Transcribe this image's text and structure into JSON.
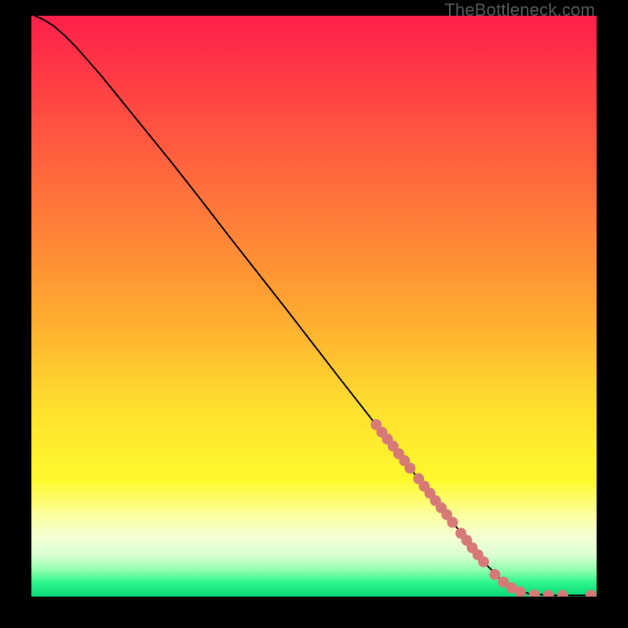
{
  "watermark": "TheBottleneck.com",
  "chart_data": {
    "type": "line",
    "title": "",
    "xlabel": "",
    "ylabel": "",
    "xlim": [
      0,
      100
    ],
    "ylim": [
      0,
      100
    ],
    "grid": false,
    "series": [
      {
        "name": "curve",
        "type": "line",
        "color": "#000000",
        "points": [
          {
            "x": 0.5,
            "y": 100.0
          },
          {
            "x": 2.0,
            "y": 99.4
          },
          {
            "x": 4.0,
            "y": 98.2
          },
          {
            "x": 6.0,
            "y": 96.5
          },
          {
            "x": 8.0,
            "y": 94.5
          },
          {
            "x": 10.0,
            "y": 92.3
          },
          {
            "x": 12.5,
            "y": 89.5
          },
          {
            "x": 15.0,
            "y": 86.5
          },
          {
            "x": 20.0,
            "y": 80.5
          },
          {
            "x": 25.0,
            "y": 74.5
          },
          {
            "x": 30.0,
            "y": 68.3
          },
          {
            "x": 35.0,
            "y": 62.0
          },
          {
            "x": 40.0,
            "y": 55.8
          },
          {
            "x": 45.0,
            "y": 49.6
          },
          {
            "x": 50.0,
            "y": 43.3
          },
          {
            "x": 55.0,
            "y": 37.0
          },
          {
            "x": 60.0,
            "y": 30.8
          },
          {
            "x": 65.0,
            "y": 24.6
          },
          {
            "x": 70.0,
            "y": 18.4
          },
          {
            "x": 75.0,
            "y": 12.2
          },
          {
            "x": 80.0,
            "y": 6.0
          },
          {
            "x": 84.0,
            "y": 2.0
          },
          {
            "x": 88.0,
            "y": 0.5
          },
          {
            "x": 92.0,
            "y": 0.2
          },
          {
            "x": 96.0,
            "y": 0.2
          },
          {
            "x": 99.5,
            "y": 0.2
          }
        ]
      },
      {
        "name": "markers",
        "type": "scatter",
        "color": "#d77a77",
        "points": [
          {
            "x": 61.0,
            "y": 29.6
          },
          {
            "x": 62.0,
            "y": 28.3
          },
          {
            "x": 63.0,
            "y": 27.1
          },
          {
            "x": 64.0,
            "y": 25.9
          },
          {
            "x": 65.0,
            "y": 24.6
          },
          {
            "x": 66.0,
            "y": 23.4
          },
          {
            "x": 67.0,
            "y": 22.1
          },
          {
            "x": 68.5,
            "y": 20.3
          },
          {
            "x": 69.5,
            "y": 19.0
          },
          {
            "x": 70.5,
            "y": 17.8
          },
          {
            "x": 71.5,
            "y": 16.5
          },
          {
            "x": 72.5,
            "y": 15.3
          },
          {
            "x": 73.5,
            "y": 14.1
          },
          {
            "x": 74.5,
            "y": 12.8
          },
          {
            "x": 76.0,
            "y": 10.9
          },
          {
            "x": 77.0,
            "y": 9.7
          },
          {
            "x": 78.0,
            "y": 8.4
          },
          {
            "x": 79.0,
            "y": 7.2
          },
          {
            "x": 80.0,
            "y": 6.0
          },
          {
            "x": 82.0,
            "y": 3.8
          },
          {
            "x": 83.5,
            "y": 2.5
          },
          {
            "x": 85.0,
            "y": 1.5
          },
          {
            "x": 86.5,
            "y": 0.8
          },
          {
            "x": 89.0,
            "y": 0.3
          },
          {
            "x": 91.5,
            "y": 0.2
          },
          {
            "x": 94.0,
            "y": 0.2
          },
          {
            "x": 99.0,
            "y": 0.2
          }
        ]
      }
    ],
    "background_gradient": {
      "stops": [
        {
          "offset": 0.0,
          "color": "#ff1f4b"
        },
        {
          "offset": 0.5,
          "color": "#ffa531"
        },
        {
          "offset": 0.68,
          "color": "#ffe12e"
        },
        {
          "offset": 0.8,
          "color": "#fff92e"
        },
        {
          "offset": 0.86,
          "color": "#fcffa0"
        },
        {
          "offset": 0.9,
          "color": "#f4ffd6"
        },
        {
          "offset": 0.93,
          "color": "#d7ffd0"
        },
        {
          "offset": 0.955,
          "color": "#8effad"
        },
        {
          "offset": 0.975,
          "color": "#30f58e"
        },
        {
          "offset": 1.0,
          "color": "#07d877"
        }
      ]
    }
  }
}
